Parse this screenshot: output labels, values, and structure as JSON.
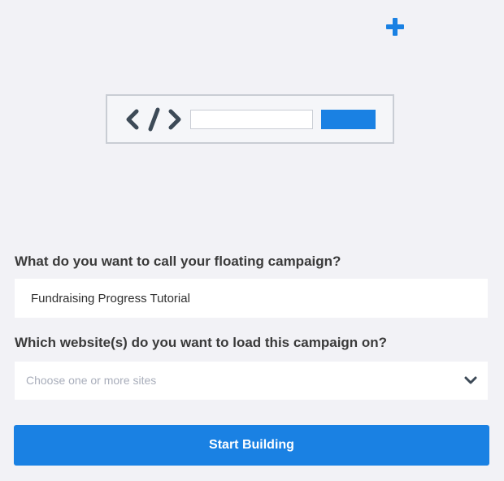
{
  "icons": {
    "add": "plus-icon",
    "illustration": "code-icon",
    "dropdown": "chevron-down-icon"
  },
  "colors": {
    "accent": "#1a81e3",
    "background": "#f2f2f6",
    "label_text": "#3a3a3a",
    "placeholder_text": "#a9aebb"
  },
  "form": {
    "campaign_name_label": "What do you want to call your floating campaign?",
    "campaign_name_value": "Fundraising Progress Tutorial",
    "sites_label": "Which website(s) do you want to load this campaign on?",
    "sites_placeholder": "Choose one or more sites",
    "submit_label": "Start Building"
  }
}
